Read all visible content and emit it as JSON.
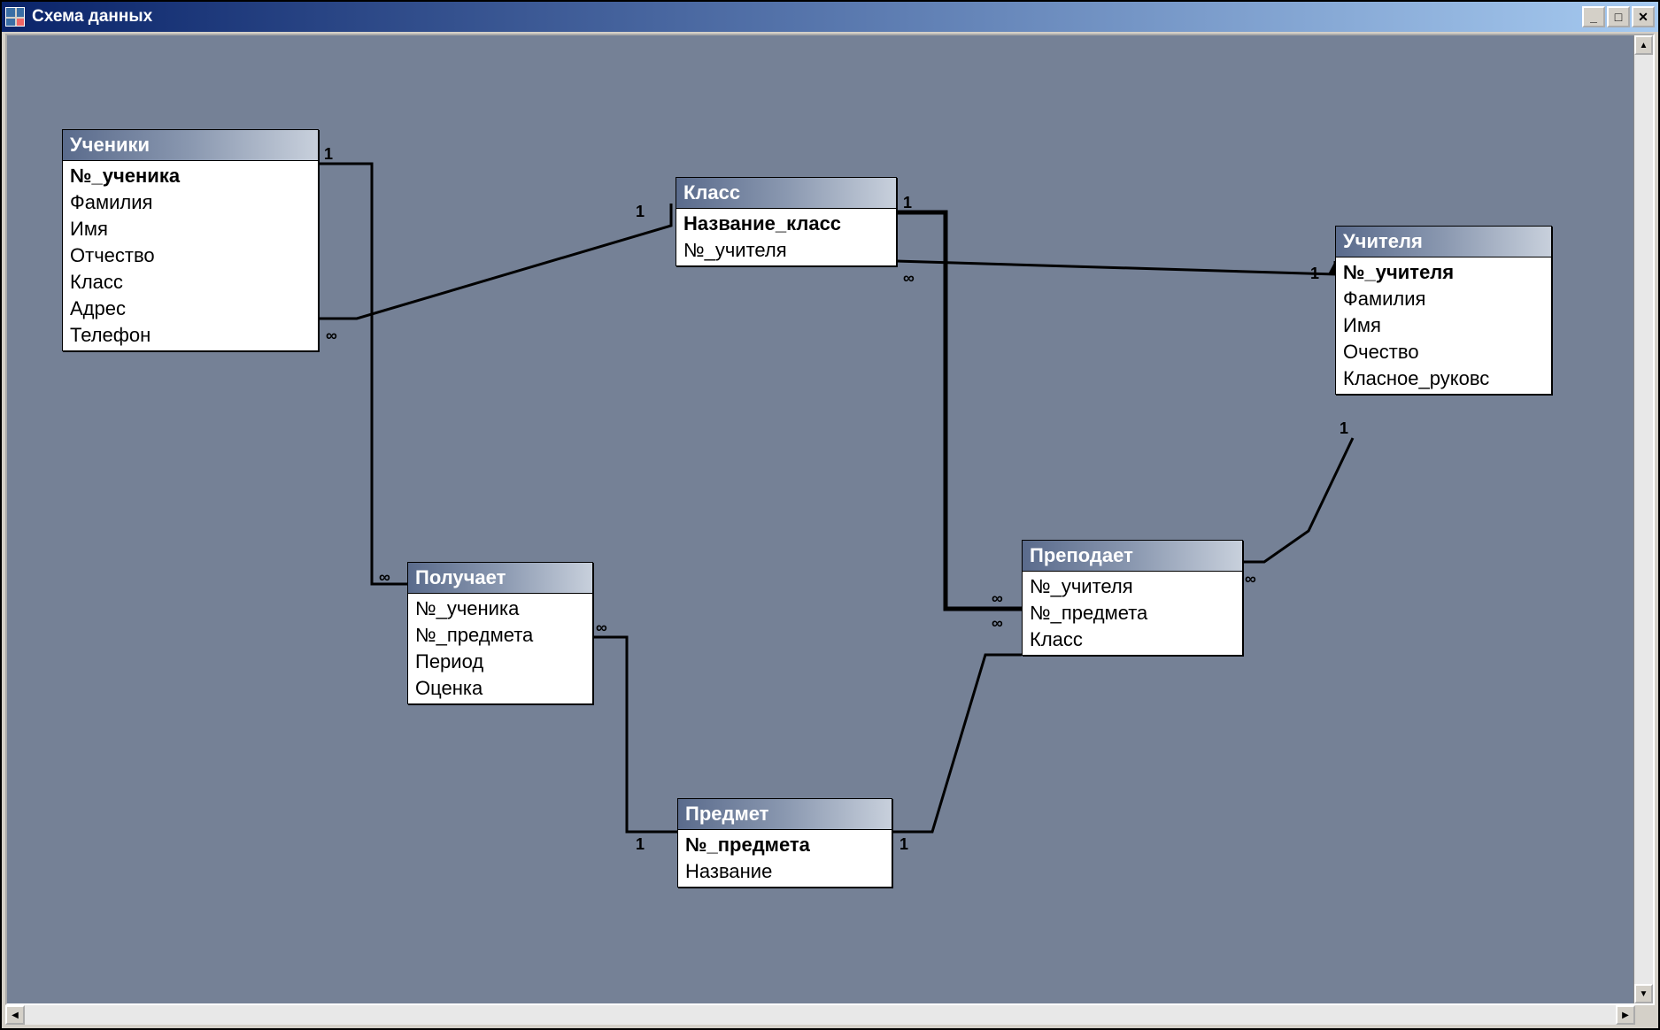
{
  "window": {
    "title": "Схема данных"
  },
  "tables": {
    "students": {
      "title": "Ученики",
      "fields": [
        "№_ученика",
        "Фамилия",
        "Имя",
        "Отчество",
        "Класс",
        "Адрес",
        "Телефон"
      ],
      "pk": [
        0
      ]
    },
    "class": {
      "title": "Класс",
      "fields": [
        "Название_класс",
        "№_учителя"
      ],
      "pk": [
        0
      ]
    },
    "teachers": {
      "title": "Учителя",
      "fields": [
        "№_учителя",
        "Фамилия",
        "Имя",
        "Очество",
        "Класное_руковс"
      ],
      "pk": [
        0
      ]
    },
    "receives": {
      "title": "Получает",
      "fields": [
        "№_ученика",
        "№_предмета",
        "Период",
        "Оценка"
      ],
      "pk": []
    },
    "teaches": {
      "title": "Преподает",
      "fields": [
        "№_учителя",
        "№_предмета",
        "Класс"
      ],
      "pk": []
    },
    "subject": {
      "title": "Предмет",
      "fields": [
        "№_предмета",
        "Название"
      ],
      "pk": [
        0
      ]
    }
  },
  "cardinality": {
    "one": "1",
    "many": "∞"
  },
  "relationships": [
    {
      "from": "students",
      "to": "receives",
      "from_card": "1",
      "to_card": "∞"
    },
    {
      "from": "students",
      "to": "class",
      "from_card": "∞",
      "to_card": "1"
    },
    {
      "from": "class",
      "to": "teachers",
      "from_card": "∞",
      "to_card": "1"
    },
    {
      "from": "class",
      "to": "teaches",
      "from_card": "1",
      "to_card": "∞"
    },
    {
      "from": "subject",
      "to": "receives",
      "from_card": "1",
      "to_card": "∞"
    },
    {
      "from": "subject",
      "to": "teaches",
      "from_card": "1",
      "to_card": "∞"
    },
    {
      "from": "teachers",
      "to": "teaches",
      "from_card": "1",
      "to_card": "∞"
    }
  ]
}
